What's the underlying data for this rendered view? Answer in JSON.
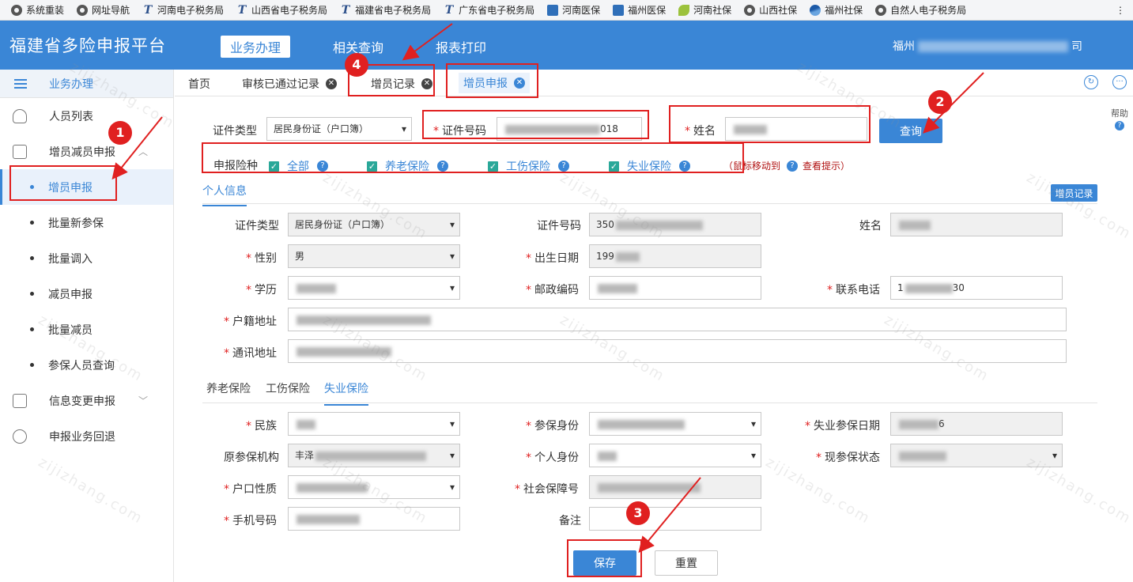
{
  "bookmarks": [
    {
      "label": "系统重装",
      "icon": "globe-icon"
    },
    {
      "label": "网址导航",
      "icon": "globe-icon"
    },
    {
      "label": "河南电子税务局",
      "icon": "tax-icon"
    },
    {
      "label": "山西省电子税务局",
      "icon": "tax-icon"
    },
    {
      "label": "福建省电子税务局",
      "icon": "tax-icon"
    },
    {
      "label": "广东省电子税务局",
      "icon": "tax-icon"
    },
    {
      "label": "河南医保",
      "icon": "medical-icon"
    },
    {
      "label": "福州医保",
      "icon": "medical-icon"
    },
    {
      "label": "河南社保",
      "icon": "leaf-icon"
    },
    {
      "label": "山西社保",
      "icon": "globe-icon"
    },
    {
      "label": "福州社保",
      "icon": "wave-icon"
    },
    {
      "label": "自然人电子税务局",
      "icon": "globe-icon"
    }
  ],
  "header": {
    "title": "福建省多险申报平台",
    "nav": [
      "业务办理",
      "相关查询",
      "报表打印"
    ],
    "user_prefix": "福州",
    "user_suffix": "司"
  },
  "sidebar": {
    "head": "业务办理",
    "items": [
      {
        "label": "人员列表"
      },
      {
        "label": "增员减员申报"
      }
    ],
    "sub_items": [
      "增员申报",
      "批量新参保",
      "批量调入",
      "减员申报",
      "批量减员",
      "参保人员查询"
    ],
    "bottom_items": [
      "信息变更申报",
      "申报业务回退"
    ]
  },
  "tabs": {
    "home": "首页",
    "items": [
      "审核已通过记录",
      "增员记录",
      "增员申报"
    ]
  },
  "query": {
    "id_type_label": "证件类型",
    "id_type_value": "居民身份证（户口簿）",
    "id_no_label": "证件号码",
    "id_no_suffix": "018",
    "name_label": "姓名",
    "query_button": "查询",
    "help": "帮助"
  },
  "insurance": {
    "label": "申报险种",
    "options": [
      "全部",
      "养老保险",
      "工伤保险",
      "失业保险"
    ],
    "hint_prefix": "（鼠标移动到",
    "hint_suffix": "查看提示）"
  },
  "personal": {
    "section_title": "个人信息",
    "record_button": "增员记录",
    "id_type_label": "证件类型",
    "id_type_value": "居民身份证（户口簿）",
    "id_no_label": "证件号码",
    "id_no_prefix": "350",
    "name_label": "姓名",
    "gender_label": "性别",
    "gender_value": "男",
    "birth_label": "出生日期",
    "birth_prefix": "199",
    "edu_label": "学历",
    "postal_label": "邮政编码",
    "phone_label": "联系电话",
    "phone_prefix": "1",
    "phone_suffix": "30",
    "huji_label": "户籍地址",
    "mail_label": "通讯地址"
  },
  "subtabs": [
    "养老保险",
    "工伤保险",
    "失业保险"
  ],
  "unemployment": {
    "ethnic_label": "民族",
    "identity_label": "参保身份",
    "ue_date_label": "失业参保日期",
    "ue_date_suffix": "6",
    "orig_org_label": "原参保机构",
    "orig_org_prefix": "丰泽",
    "personal_id_label": "个人身份",
    "status_label": "现参保状态",
    "hukou_label": "户口性质",
    "ss_no_label": "社会保障号",
    "mobile_label": "手机号码",
    "remark_label": "备注"
  },
  "actions": {
    "save": "保存",
    "reset": "重置"
  },
  "annotations": [
    "1",
    "2",
    "3",
    "4"
  ],
  "watermark": "zijizhang.com",
  "colors": {
    "brand": "#3a86d6",
    "annotation": "#e02020",
    "check": "#2aa899"
  }
}
